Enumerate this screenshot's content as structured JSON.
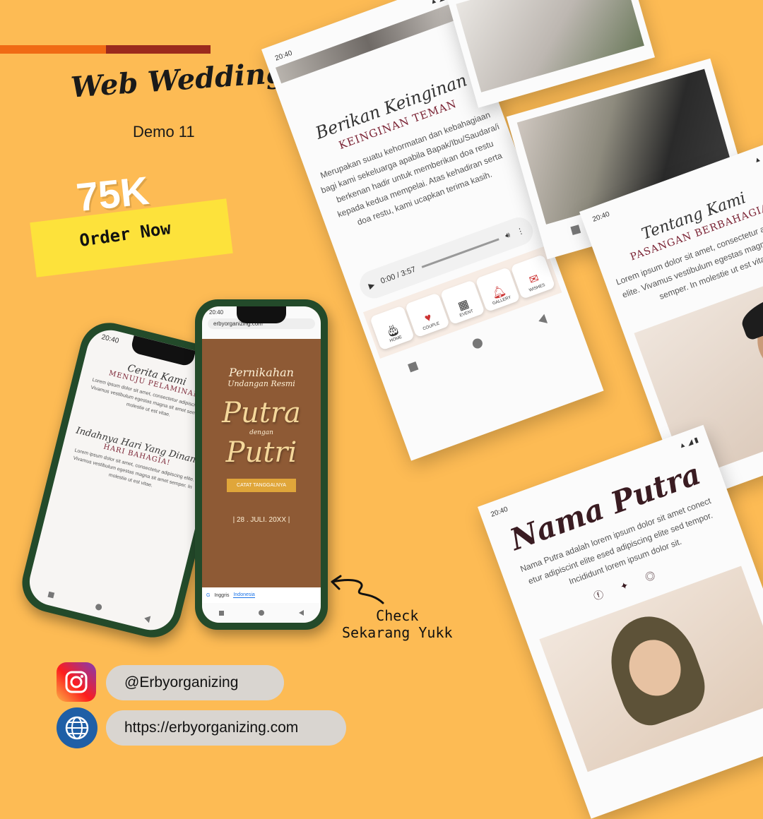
{
  "brand": {
    "title": "Web Wedding",
    "demo": "Demo 11",
    "price": "75K",
    "cta": "Order Now",
    "check_line1": "Check",
    "check_line2": "Sekarang Yukk"
  },
  "social": {
    "instagram": "@Erbyorganizing",
    "website": "https://erbyorganizing.com"
  },
  "wishes_card": {
    "time": "20:40",
    "script_title": "Berikan Keinginan",
    "heading": "KEINGINAN TEMAN",
    "body": "Merupakan suatu kehormatan dan kebahagiaan bagi kami sekeluarga apabila Bapak/Ibu/Saudara/i berkenan hadir untuk memberikan doa restu kepada kedua mempelai. Atas kehadiran serta doa restu, kami ucapkan terima kasih.",
    "audio_time": "0:00 / 3:57",
    "menu": [
      "HOME",
      "COUPLE",
      "EVENT",
      "GALLERY",
      "WISHES"
    ]
  },
  "about_card": {
    "time": "20:40",
    "script_title": "Tentang Kami",
    "heading": "PASANGAN BERBAHAGIA",
    "body": "Lorem ipsum dolor sit amet, consectetur adipiscing elite. Vivamus vestibulum egestas magna sit amet semper. In molestie ut est vitae."
  },
  "groom_card": {
    "time": "20:40",
    "name": "Nama Putra",
    "body": "Nama Putra adalah lorem ipsum dolor sit amet conect etur adipiscint elite esed adipiscing elite sed tempor. Incididunt lorem ipsum dolor sit."
  },
  "phone_left": {
    "time": "20:40",
    "script1": "Cerita Kami",
    "heading1": "MENUJU PELAMINAN",
    "body1": "Lorem ipsum dolor sit amet, consectetur adipiscing elite. Vivamus vestibulum egestas magna sit amet semper. In molestie ut est vitae.",
    "script2": "Indahnya Hari Yang Dinanti",
    "heading2": "HARI BAHAGIA!",
    "body2": "Lorem ipsum dolor sit amet, consectetur adipiscing elite. Vivamus vestibulum egestas magna sit amet semper. In molestie ut est vitae."
  },
  "phone_right": {
    "time": "20:40",
    "url": "erbyorganizing.com",
    "script_top": "Pernikahan",
    "subtitle": "Undangan Resmi",
    "name1": "Putra",
    "connector": "dengan",
    "name2": "Putri",
    "button": "CATAT TANGGALNYA",
    "date": "| 28 . JULI. 20XX |",
    "lang1": "Inggris",
    "lang2": "Indonesia"
  },
  "colors": {
    "background": "#fdbb54",
    "accent_orange": "#f06a14",
    "accent_maroon": "#9b2a1d",
    "highlight": "#fde23b"
  }
}
